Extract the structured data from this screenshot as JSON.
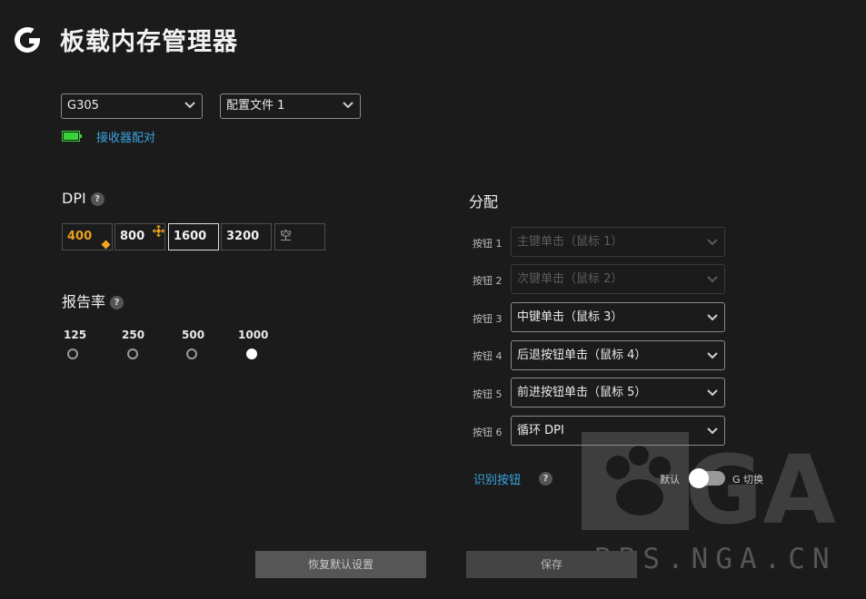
{
  "app": {
    "title": "板载内存管理器"
  },
  "device": {
    "selected": "G305"
  },
  "profile": {
    "selected": "配置文件 1"
  },
  "receiver": {
    "pair_link": "接收器配对",
    "battery_color": "#3bd13b"
  },
  "dpi": {
    "title": "DPI",
    "help": "?",
    "levels": [
      "400",
      "800",
      "1600",
      "3200",
      "空"
    ],
    "active_color": "#e8a020"
  },
  "report_rate": {
    "title": "报告率",
    "help": "?",
    "options": [
      "125",
      "250",
      "500",
      "1000"
    ],
    "selected": "1000"
  },
  "assignment": {
    "title": "分配",
    "buttons": [
      {
        "label": "按钮 1",
        "value": "主键单击（鼠标 1）",
        "disabled": true
      },
      {
        "label": "按钮 2",
        "value": "次键单击（鼠标 2）",
        "disabled": true
      },
      {
        "label": "按钮 3",
        "value": "中键单击（鼠标 3）",
        "disabled": false
      },
      {
        "label": "按钮 4",
        "value": "后退按钮单击（鼠标 4）",
        "disabled": false
      },
      {
        "label": "按钮 5",
        "value": "前进按钮单击（鼠标 5）",
        "disabled": false
      },
      {
        "label": "按钮 6",
        "value": "循环 DPI",
        "disabled": false
      }
    ],
    "identify_link": "识别按钮",
    "help": "?",
    "toggle_left": "默认",
    "toggle_right": "G 切换"
  },
  "actions": {
    "reset": "恢复默认设置",
    "save": "保存"
  },
  "watermark": {
    "logo_text": "NGA",
    "text": "BBS.NGA.CN"
  },
  "colors": {
    "link": "#3aa4e0",
    "background": "#1b1b1b"
  }
}
